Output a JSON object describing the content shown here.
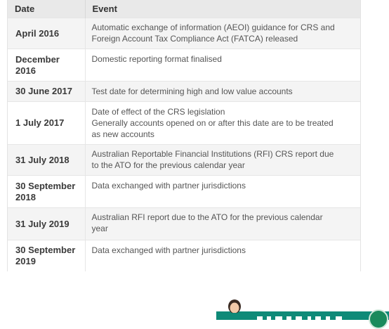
{
  "table": {
    "headers": {
      "date": "Date",
      "event": "Event"
    },
    "rows": [
      {
        "date": "April 2016",
        "event": [
          "Automatic exchange of information (AEOI) guidance for CRS and",
          "Foreign Account Tax Compliance Act (FATCA) released"
        ]
      },
      {
        "date": "December 2016",
        "event": [
          "Domestic reporting format finalised"
        ]
      },
      {
        "date": "30  June 2017",
        "event": [
          "Test date for determining high and low value accounts"
        ]
      },
      {
        "date": "1  July 2017",
        "event": [
          "Date of effect of the CRS legislation",
          "Generally accounts opened on or after this date are to be treated",
          "as new accounts"
        ]
      },
      {
        "date": "31  July 2018",
        "event": [
          "Australian Reportable Financial Institutions (RFI) CRS report due",
          "to the ATO for the previous calendar year"
        ]
      },
      {
        "date": "30  September 2018",
        "event": [
          "Data exchanged with partner jurisdictions"
        ]
      },
      {
        "date": "31  July 2019",
        "event": [
          "Australian RFI report due to the ATO for the previous calendar",
          "year"
        ]
      },
      {
        "date": "30  September 2019",
        "event": [
          "Data exchanged with partner jurisdictions"
        ]
      }
    ]
  },
  "widget": {
    "icons": {
      "avatar": "support-agent-avatar-icon",
      "button": "circle-button-icon"
    },
    "colors": {
      "bar": "#0f8a78",
      "button": "#1a8a5c"
    }
  }
}
